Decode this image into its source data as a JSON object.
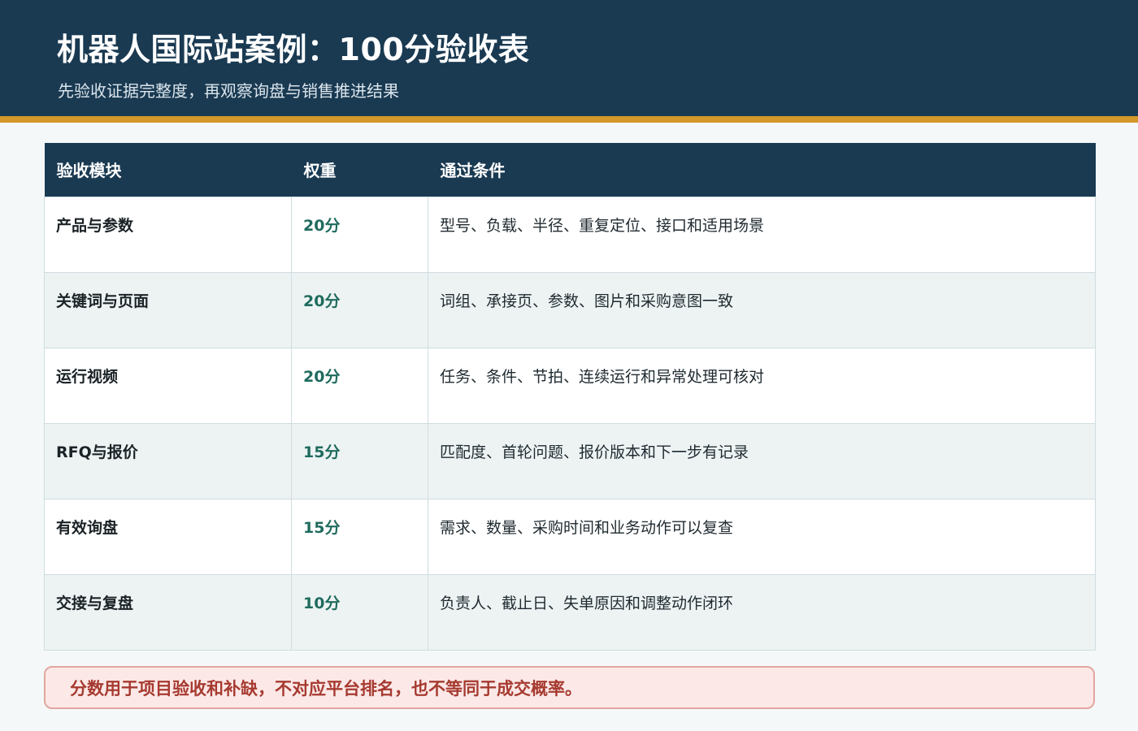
{
  "header": {
    "title": "机器人国际站案例：100分验收表",
    "subtitle": "先验收证据完整度，再观察询盘与销售推进结果"
  },
  "table": {
    "columns": [
      "验收模块",
      "权重",
      "通过条件"
    ],
    "rows": [
      {
        "module": "产品与参数",
        "weight": "20分",
        "criteria": "型号、负载、半径、重复定位、接口和适用场景"
      },
      {
        "module": "关键词与页面",
        "weight": "20分",
        "criteria": "词组、承接页、参数、图片和采购意图一致"
      },
      {
        "module": "运行视频",
        "weight": "20分",
        "criteria": "任务、条件、节拍、连续运行和异常处理可核对"
      },
      {
        "module": "RFQ与报价",
        "weight": "15分",
        "criteria": "匹配度、首轮问题、报价版本和下一步有记录"
      },
      {
        "module": "有效询盘",
        "weight": "15分",
        "criteria": "需求、数量、采购时间和业务动作可以复查"
      },
      {
        "module": "交接与复盘",
        "weight": "10分",
        "criteria": "负责人、截止日、失单原因和调整动作闭环"
      }
    ]
  },
  "note": {
    "text": "分数用于项目验收和补缺，不对应平台排名，也不等同于成交概率。"
  },
  "colors": {
    "header_bg": "#1a3a52",
    "accent": "#d4982a",
    "weight_text": "#1f6b5e",
    "note_text": "#a63a30"
  }
}
